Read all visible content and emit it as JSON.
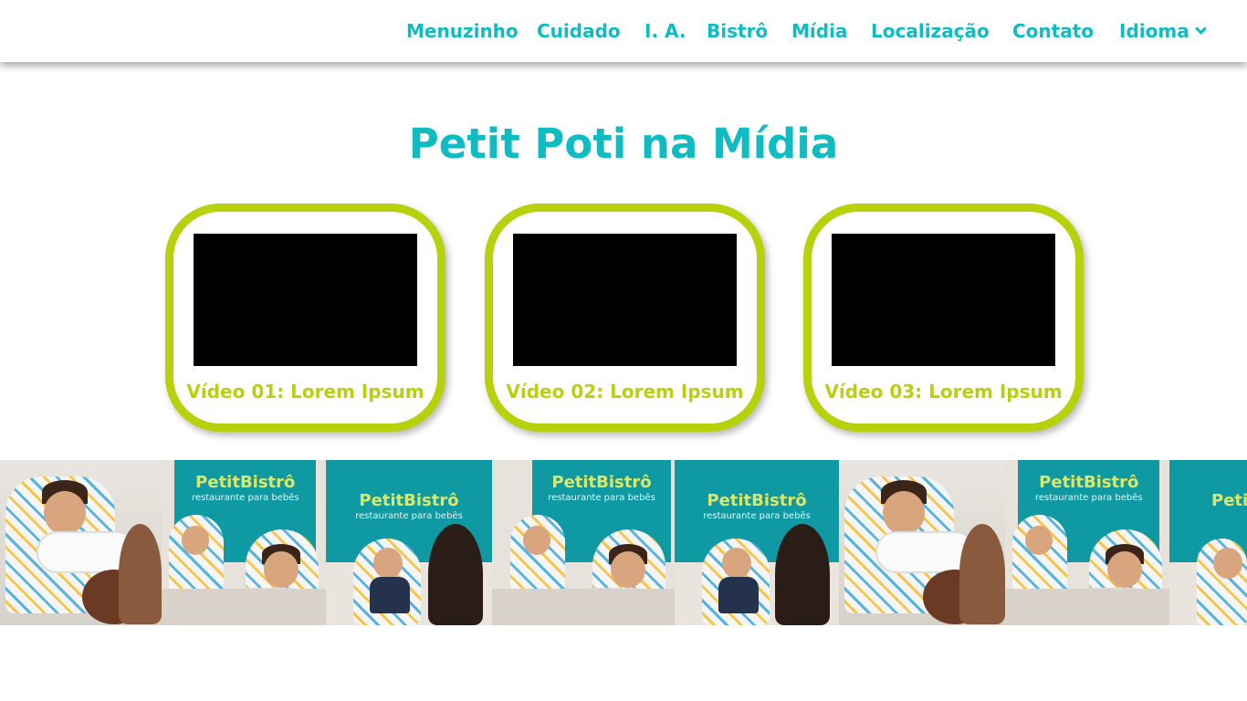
{
  "nav": {
    "items": [
      "Menuzinho",
      "Cuidado",
      "I. A.",
      "Bistrô",
      "Mídia",
      "Localização",
      "Contato"
    ],
    "language_label": "Idioma",
    "language_icon": "chevron-down-icon"
  },
  "page": {
    "title": "Petit Poti na Mídia"
  },
  "videos": [
    {
      "caption": "Vídeo 01: Lorem Ipsum"
    },
    {
      "caption": "Vídeo 02: Lorem Ipsum"
    },
    {
      "caption": "Vídeo 03: Lorem Ipsum"
    }
  ],
  "photo_strip": {
    "sign_brand": "PetitBistrô",
    "sign_tagline": "restaurante para bebês"
  },
  "colors": {
    "accent_teal": "#0fbcc2",
    "accent_lime": "#b7d20c",
    "video_background": "#000000"
  }
}
